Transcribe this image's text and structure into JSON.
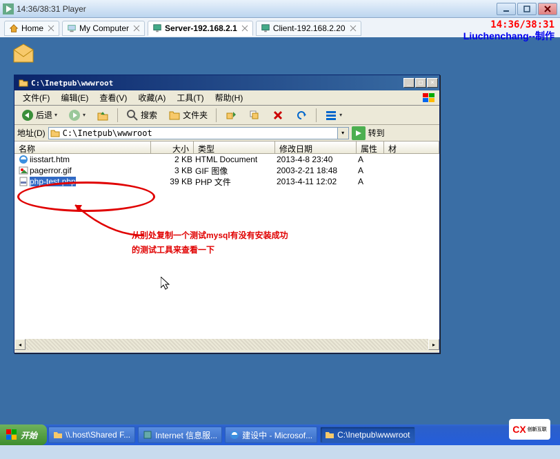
{
  "player": {
    "title": "14:36/38:31 Player",
    "controls": {
      "min": "—",
      "max": "▢",
      "close": "×"
    }
  },
  "tabs": [
    {
      "label": "Home",
      "icon": "home",
      "active": false
    },
    {
      "label": "My Computer",
      "icon": "computer",
      "active": false
    },
    {
      "label": "Server-192.168.2.1",
      "icon": "remote",
      "active": true
    },
    {
      "label": "Client-192.168.2.20",
      "icon": "remote",
      "active": false
    }
  ],
  "overlay": {
    "time": "14:36/38:31",
    "credit": "Liuchenchang--制作"
  },
  "explorer": {
    "title": "C:\\Inetpub\\wwwroot",
    "menu": {
      "file": "文件(F)",
      "edit": "编辑(E)",
      "view": "查看(V)",
      "fav": "收藏(A)",
      "tools": "工具(T)",
      "help": "帮助(H)"
    },
    "toolbar": {
      "back": "后退",
      "search": "搜索",
      "folders": "文件夹"
    },
    "address": {
      "label": "地址(D)",
      "path": "C:\\Inetpub\\wwwroot",
      "go": "转到"
    },
    "columns": {
      "name": "名称",
      "size": "大小",
      "type": "类型",
      "date": "修改日期",
      "attr": "属性",
      "ext": "材"
    },
    "files": [
      {
        "name": "iisstart.htm",
        "size": "2 KB",
        "type": "HTML Document",
        "date": "2013-4-8 23:40",
        "attr": "A",
        "icon": "ie",
        "selected": false
      },
      {
        "name": "pagerror.gif",
        "size": "3 KB",
        "type": "GIF 图像",
        "date": "2003-2-21 18:48",
        "attr": "A",
        "icon": "gif",
        "selected": false
      },
      {
        "name": "php-test.php",
        "size": "39 KB",
        "type": "PHP 文件",
        "date": "2013-4-11 12:02",
        "attr": "A",
        "icon": "php",
        "selected": true
      }
    ]
  },
  "annotation": {
    "line1": "从别处复制一个测试mysql有没有安装成功",
    "line2": "的测试工具来查看一下"
  },
  "taskbar": {
    "start": "开始",
    "items": [
      {
        "label": "\\\\.host\\Shared F...",
        "icon": "folder"
      },
      {
        "label": "Internet 信息服...",
        "icon": "iis"
      },
      {
        "label": "建设中 - Microsof...",
        "icon": "ie"
      },
      {
        "label": "C:\\Inetpub\\wwwroot",
        "icon": "folder",
        "active": true
      }
    ]
  },
  "watermark": {
    "brand": "CX",
    "sub": "创新互联"
  }
}
